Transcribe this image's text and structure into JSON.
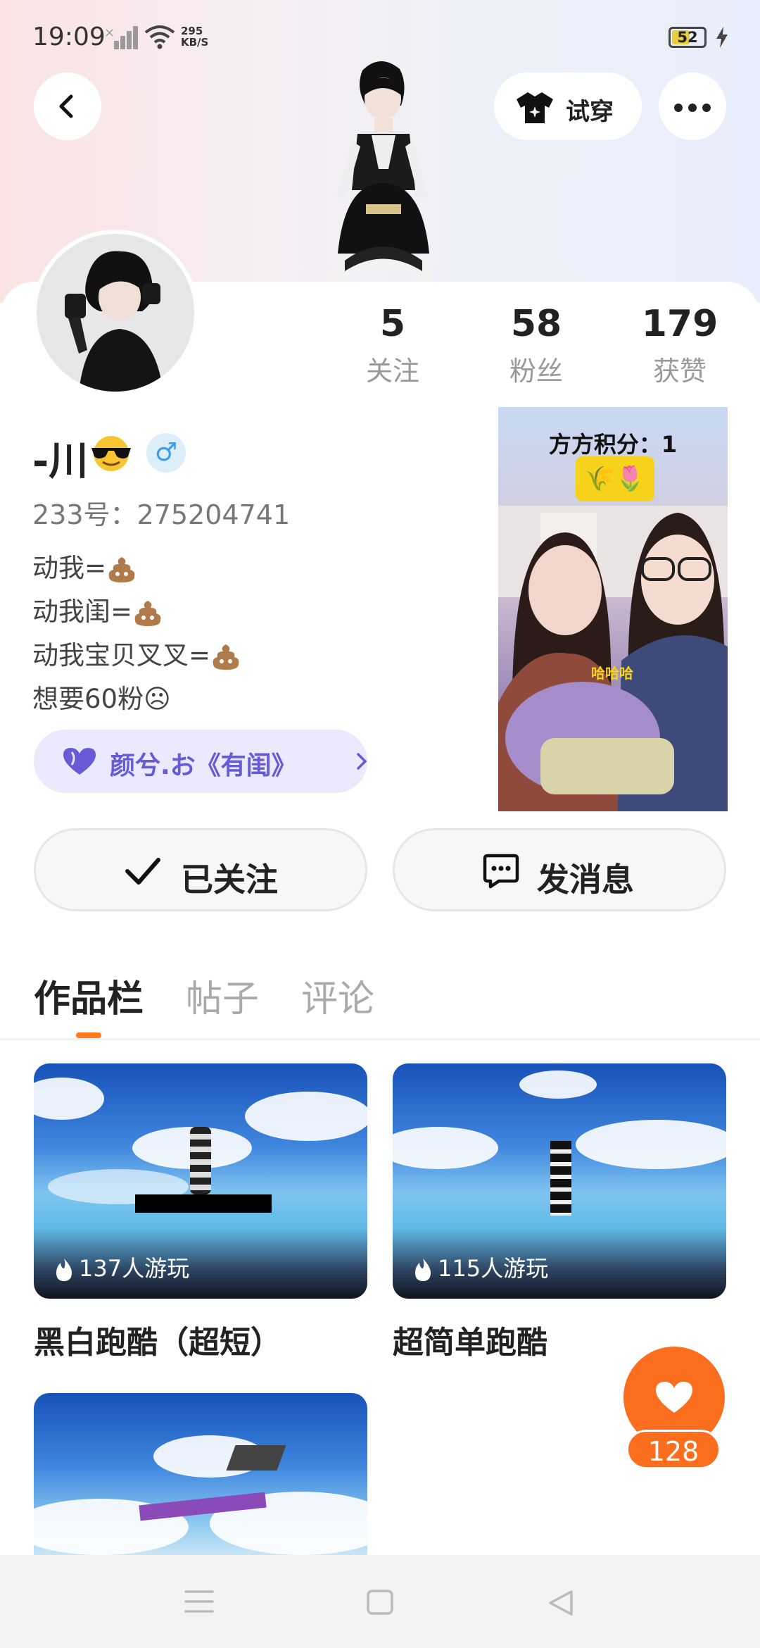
{
  "status_bar": {
    "time": "19:09",
    "net_speed_value": "295",
    "net_speed_unit": "KB/S",
    "battery": "52"
  },
  "top_nav": {
    "tryon_label": "试穿"
  },
  "profile": {
    "stats": [
      {
        "value": "5",
        "label": "关注"
      },
      {
        "value": "58",
        "label": "粉丝"
      },
      {
        "value": "179",
        "label": "获赞"
      }
    ],
    "name": "-川",
    "uid": "233号：275204741",
    "bio_lines": [
      "动我=",
      "动我闺=",
      "动我宝贝叉叉="
    ],
    "bio_last": "想要60粉☹",
    "club": "颜兮.お《有闺》"
  },
  "live_card": {
    "score": "方方积分：1",
    "badge": "🌾🌷",
    "overlay": "哈哈哈"
  },
  "actions": {
    "followed_label": "已关注",
    "message_label": "发消息"
  },
  "tabs": [
    {
      "label": "作品栏",
      "active": true
    },
    {
      "label": "帖子",
      "active": false
    },
    {
      "label": "评论",
      "active": false
    }
  ],
  "works": [
    {
      "plays": "137人游玩",
      "title": "黑白跑酷（超短）"
    },
    {
      "plays": "115人游玩",
      "title": "超简单跑酷"
    },
    {
      "plays": "",
      "title": ""
    }
  ],
  "like": {
    "count": "128"
  },
  "colors": {
    "accent": "#fb6e1e",
    "club_purple": "#6a59d6",
    "gender_blue": "#3a9ee8"
  },
  "icons": [
    "back-icon",
    "shirt-icon",
    "more-icon",
    "heart-icon",
    "chevron-right-icon",
    "check-icon",
    "message-icon",
    "flame-icon",
    "like-heart-icon",
    "menu-icon",
    "home-icon",
    "back-triangle-icon"
  ]
}
